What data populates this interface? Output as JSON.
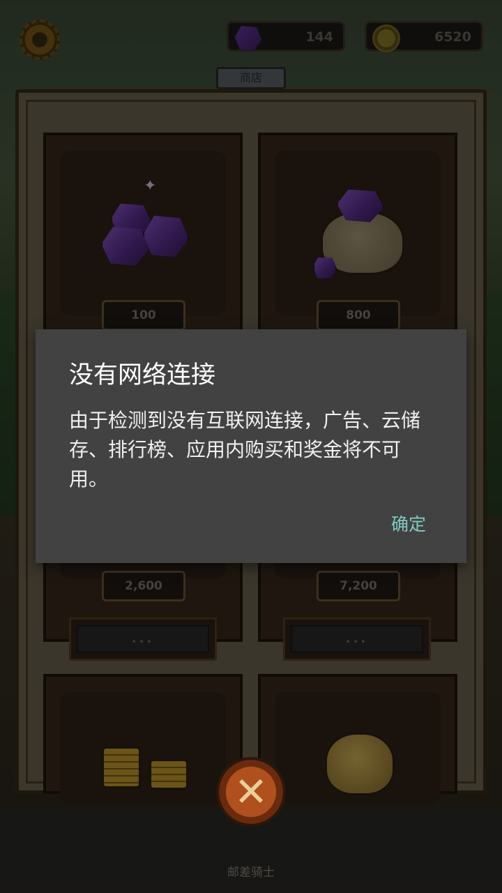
{
  "hud": {
    "gems": "144",
    "coins": "6520",
    "settings_icon": "gear-icon",
    "gem_icon": "gem-icon",
    "coin_icon": "coin-icon"
  },
  "shop": {
    "tab_label": "商店",
    "items": [
      {
        "price": "100",
        "icon": "gem-pile-icon"
      },
      {
        "price": "800",
        "icon": "gem-bag-icon"
      },
      {
        "price": "2,600",
        "more_label": "..."
      },
      {
        "price": "7,200",
        "more_label": "..."
      },
      {
        "icon": "coin-stacks-icon"
      },
      {
        "icon": "coin-bag-icon"
      }
    ],
    "close_icon": "close-icon"
  },
  "footer": {
    "label": "邮差骑士"
  },
  "dialog": {
    "title": "没有网络连接",
    "message": "由于检测到没有互联网连接，广告、云储存、排行榜、应用内购买和奖金将不可用。",
    "ok_label": "确定"
  },
  "colors": {
    "dialog_bg": "#424242",
    "accent": "#80cbc4"
  }
}
